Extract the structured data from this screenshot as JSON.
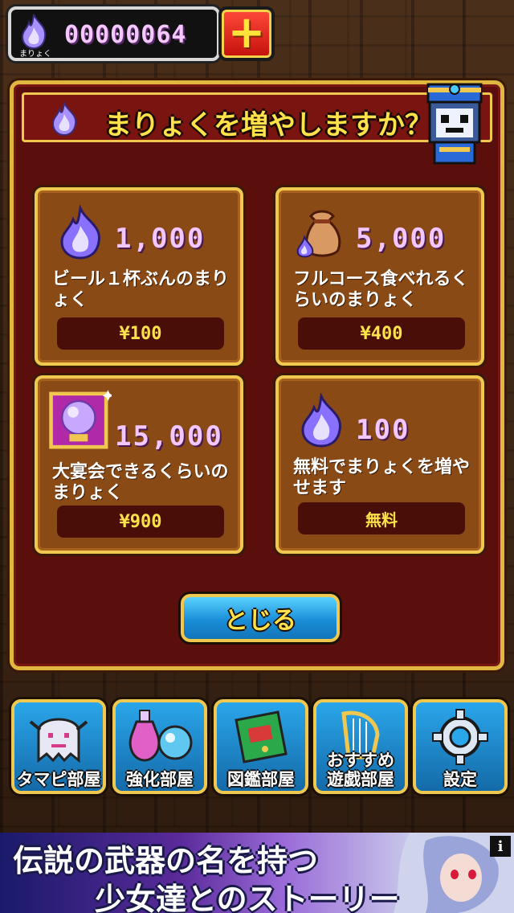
{
  "currency": {
    "caption": "まりょく",
    "amount": "00000064",
    "add_symbol": "+"
  },
  "modal": {
    "title": "まりょくを増やしますか？",
    "cards": [
      {
        "amount": "1,000",
        "description": "ビール１杯ぶんのまりょく",
        "price": "¥100"
      },
      {
        "amount": "5,000",
        "description": "フルコース食べれるくらいのまりょく",
        "price": "¥400"
      },
      {
        "amount": "15,000",
        "description": "大宴会できるくらいのまりょく",
        "price": "¥900"
      },
      {
        "amount": "100",
        "description": "無料でまりょくを増やせます",
        "price": "無料"
      }
    ],
    "close_label": "とじる"
  },
  "nav": [
    {
      "label": "タマピ部屋",
      "icon": "ghost-icon"
    },
    {
      "label": "強化部屋",
      "icon": "potion-icon"
    },
    {
      "label": "図鑑部屋",
      "icon": "book-icon"
    },
    {
      "label": "おすすめ\n遊戯部屋",
      "icon": "harp-icon"
    },
    {
      "label": "設定",
      "icon": "gear-icon"
    }
  ],
  "ad": {
    "line1": "伝説の武器の名を持つ",
    "line2": "少女達とのストーリー",
    "info": "i"
  },
  "colors": {
    "accent_gold": "#f0c850",
    "modal_bg": "#5a0f0c",
    "card_bg": "#8a4a16",
    "mana_pink": "#f2c6ff",
    "nav_blue": "#2aa6ea"
  }
}
